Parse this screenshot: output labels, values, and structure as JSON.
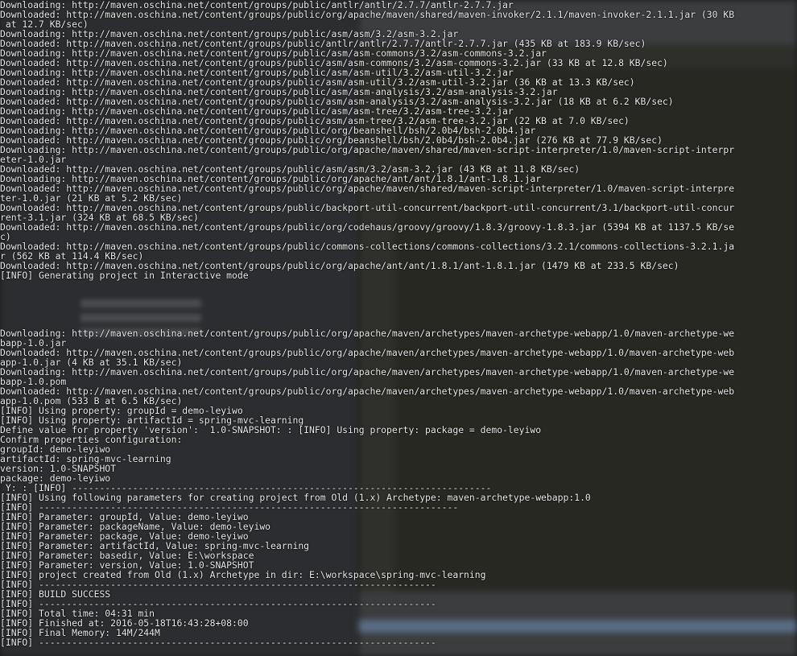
{
  "editor_background": {
    "line_numbers": [
      "",
      "",
      "",
      "",
      "",
      "",
      "",
      "",
      "",
      "",
      "",
      "",
      "",
      "",
      "",
      "",
      "",
      "",
      "",
      "",
      "",
      "",
      "",
      "",
      "",
      "",
      ""
    ],
    "code_lines": [
      "",
      "",
      "",
      "",
      "",
      "",
      "",
      "",
      "",
      "",
      "",
      "",
      "",
      "",
      "",
      "",
      "",
      "",
      "",
      "",
      "",
      "",
      "",
      "",
      "",
      "",
      ""
    ],
    "bottom_tabs": ""
  },
  "console": {
    "lines": [
      "Downloading: http://maven.oschina.net/content/groups/public/antlr/antlr/2.7.7/antlr-2.7.7.jar",
      "Downloaded: http://maven.oschina.net/content/groups/public/org/apache/maven/shared/maven-invoker/2.1.1/maven-invoker-2.1.1.jar (30 KB",
      " at 12.7 KB/sec)",
      "Downloading: http://maven.oschina.net/content/groups/public/asm/asm/3.2/asm-3.2.jar",
      "Downloaded: http://maven.oschina.net/content/groups/public/antlr/antlr/2.7.7/antlr-2.7.7.jar (435 KB at 183.9 KB/sec)",
      "Downloading: http://maven.oschina.net/content/groups/public/asm/asm-commons/3.2/asm-commons-3.2.jar",
      "Downloaded: http://maven.oschina.net/content/groups/public/asm/asm-commons/3.2/asm-commons-3.2.jar (33 KB at 12.8 KB/sec)",
      "Downloading: http://maven.oschina.net/content/groups/public/asm/asm-util/3.2/asm-util-3.2.jar",
      "Downloaded: http://maven.oschina.net/content/groups/public/asm/asm-util/3.2/asm-util-3.2.jar (36 KB at 13.3 KB/sec)",
      "Downloading: http://maven.oschina.net/content/groups/public/asm/asm-analysis/3.2/asm-analysis-3.2.jar",
      "Downloaded: http://maven.oschina.net/content/groups/public/asm/asm-analysis/3.2/asm-analysis-3.2.jar (18 KB at 6.2 KB/sec)",
      "Downloading: http://maven.oschina.net/content/groups/public/asm/asm-tree/3.2/asm-tree-3.2.jar",
      "Downloaded: http://maven.oschina.net/content/groups/public/asm/asm-tree/3.2/asm-tree-3.2.jar (22 KB at 7.0 KB/sec)",
      "Downloading: http://maven.oschina.net/content/groups/public/org/beanshell/bsh/2.0b4/bsh-2.0b4.jar",
      "Downloaded: http://maven.oschina.net/content/groups/public/org/beanshell/bsh/2.0b4/bsh-2.0b4.jar (276 KB at 77.9 KB/sec)",
      "Downloading: http://maven.oschina.net/content/groups/public/org/apache/maven/shared/maven-script-interpreter/1.0/maven-script-interpr",
      "eter-1.0.jar",
      "Downloaded: http://maven.oschina.net/content/groups/public/asm/asm/3.2/asm-3.2.jar (43 KB at 11.8 KB/sec)",
      "Downloading: http://maven.oschina.net/content/groups/public/org/apache/ant/ant/1.8.1/ant-1.8.1.jar",
      "Downloaded: http://maven.oschina.net/content/groups/public/org/apache/maven/shared/maven-script-interpreter/1.0/maven-script-interpre",
      "ter-1.0.jar (21 KB at 5.2 KB/sec)",
      "Downloaded: http://maven.oschina.net/content/groups/public/backport-util-concurrent/backport-util-concurrent/3.1/backport-util-concur",
      "rent-3.1.jar (324 KB at 68.5 KB/sec)",
      "Downloaded: http://maven.oschina.net/content/groups/public/org/codehaus/groovy/groovy/1.8.3/groovy-1.8.3.jar (5394 KB at 1137.5 KB/se",
      "c)",
      "Downloaded: http://maven.oschina.net/content/groups/public/commons-collections/commons-collections/3.2.1/commons-collections-3.2.1.ja",
      "r (562 KB at 114.4 KB/sec)",
      "Downloaded: http://maven.oschina.net/content/groups/public/org/apache/ant/ant/1.8.1/ant-1.8.1.jar (1479 KB at 233.5 KB/sec)",
      "[INFO] Generating project in Interactive mode",
      "",
      "",
      "",
      "",
      "",
      "Downloading: http://maven.oschina.net/content/groups/public/org/apache/maven/archetypes/maven-archetype-webapp/1.0/maven-archetype-we",
      "bapp-1.0.jar",
      "Downloaded: http://maven.oschina.net/content/groups/public/org/apache/maven/archetypes/maven-archetype-webapp/1.0/maven-archetype-web",
      "app-1.0.jar (4 KB at 35.1 KB/sec)",
      "Downloading: http://maven.oschina.net/content/groups/public/org/apache/maven/archetypes/maven-archetype-webapp/1.0/maven-archetype-we",
      "bapp-1.0.pom",
      "Downloaded: http://maven.oschina.net/content/groups/public/org/apache/maven/archetypes/maven-archetype-webapp/1.0/maven-archetype-web",
      "app-1.0.pom (533 B at 6.5 KB/sec)",
      "[INFO] Using property: groupId = demo-leyiwo",
      "[INFO] Using property: artifactId = spring-mvc-learning",
      "Define value for property 'version':  1.0-SNAPSHOT: : [INFO] Using property: package = demo-leyiwo",
      "Confirm properties configuration:",
      "groupId: demo-leyiwo",
      "artifactId: spring-mvc-learning",
      "version: 1.0-SNAPSHOT",
      "package: demo-leyiwo",
      " Y: : [INFO] ----------------------------------------------------------------------------",
      "[INFO] Using following parameters for creating project from Old (1.x) Archetype: maven-archetype-webapp:1.0",
      "[INFO] ----------------------------------------------------------------------------",
      "[INFO] Parameter: groupId, Value: demo-leyiwo",
      "[INFO] Parameter: packageName, Value: demo-leyiwo",
      "[INFO] Parameter: package, Value: demo-leyiwo",
      "[INFO] Parameter: artifactId, Value: spring-mvc-learning",
      "[INFO] Parameter: basedir, Value: E:\\workspace",
      "[INFO] Parameter: version, Value: 1.0-SNAPSHOT",
      "[INFO] project created from Old (1.x) Archetype in dir: E:\\workspace\\spring-mvc-learning",
      "[INFO] ------------------------------------------------------------------------",
      "[INFO] BUILD SUCCESS",
      "[INFO] ------------------------------------------------------------------------",
      "[INFO] Total time: 04:31 min",
      "[INFO] Finished at: 2016-05-18T16:43:28+08:00",
      "[INFO] Final Memory: 14M/244M",
      "[INFO] ------------------------------------------------------------------------"
    ]
  }
}
